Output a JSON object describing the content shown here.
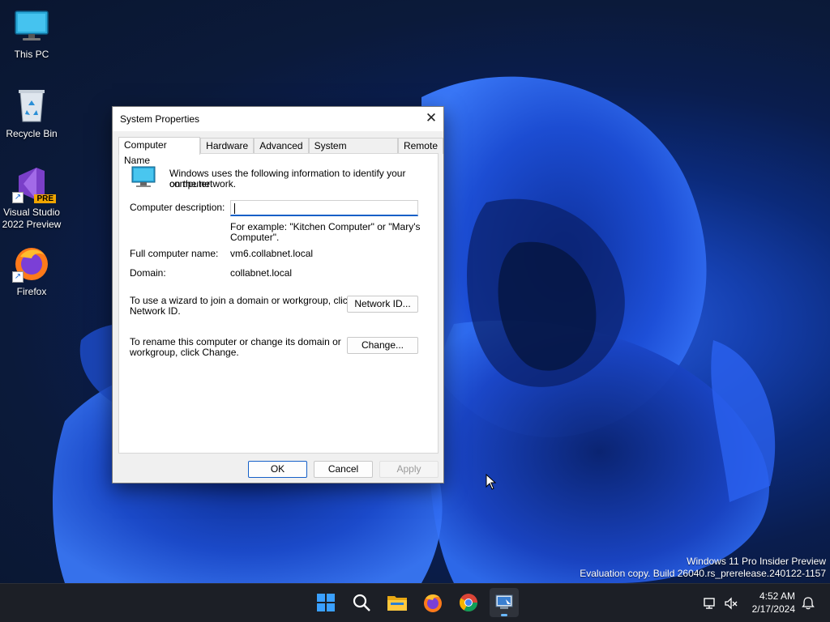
{
  "desktop": {
    "icons": [
      {
        "label": "This PC"
      },
      {
        "label": "Recycle Bin"
      },
      {
        "label": "Visual Studio 2022 Preview",
        "badge": "PRE"
      },
      {
        "label": "Firefox"
      }
    ]
  },
  "dialog": {
    "title": "System Properties",
    "close_glyph": "✕",
    "tabs": [
      "Computer Name",
      "Hardware",
      "Advanced",
      "System Protection",
      "Remote"
    ],
    "active_tab": "Computer Name",
    "intro_line1": "Windows uses the following information to identify your computer",
    "intro_line2": "on the network.",
    "description_label": "Computer description:",
    "description_value": "",
    "example_line1": "For example: \"Kitchen Computer\" or \"Mary's",
    "example_line2": "Computer\".",
    "full_name_label": "Full computer name:",
    "full_name_value": "vm6.collabnet.local",
    "domain_label": "Domain:",
    "domain_value": "collabnet.local",
    "wizard_line1": "To use a wizard to join a domain or workgroup, click",
    "wizard_line2": "Network ID.",
    "network_id_button": "Network ID...",
    "rename_line1": "To rename this computer or change its domain or",
    "rename_line2": "workgroup, click Change.",
    "change_button": "Change...",
    "ok_button": "OK",
    "cancel_button": "Cancel",
    "apply_button": "Apply"
  },
  "watermark": {
    "line1": "Windows 11 Pro Insider Preview",
    "line2": "Evaluation copy. Build 26040.rs_prerelease.240122-1157"
  },
  "taskbar": {
    "items": [
      "start-icon",
      "search-icon",
      "file-explorer-icon",
      "firefox-icon",
      "chrome-icon",
      "system-properties-icon"
    ],
    "time": "4:52 AM",
    "date": "2/17/2024"
  },
  "colors": {
    "accent": "#1560c8",
    "taskbar": "#1c1f26"
  }
}
